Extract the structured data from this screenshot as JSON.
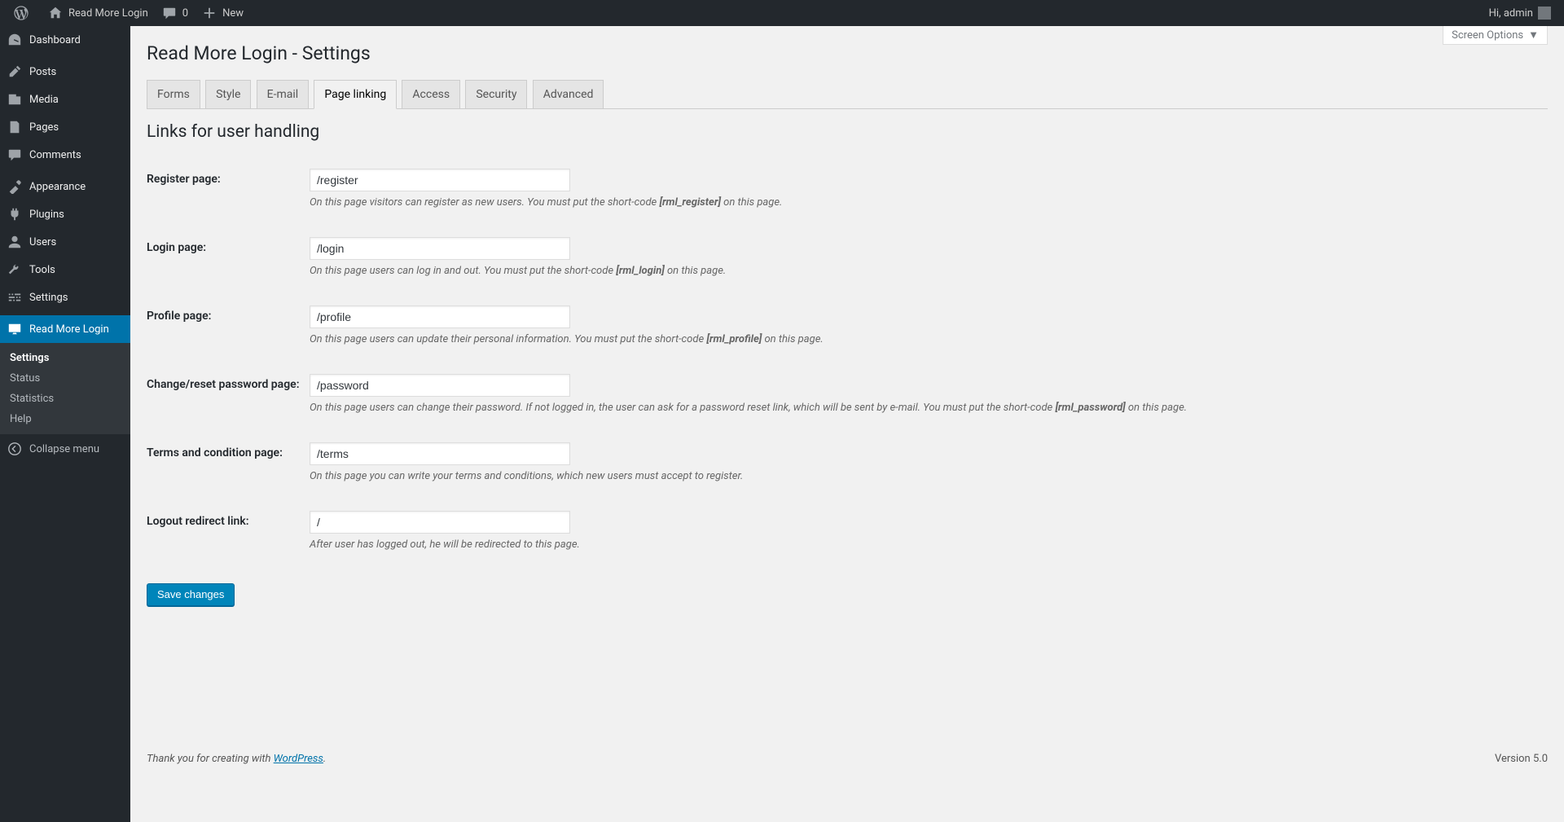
{
  "adminbar": {
    "site_name": "Read More Login",
    "comments_count": "0",
    "new_label": "New",
    "greeting": "Hi, admin"
  },
  "menu": {
    "items": [
      {
        "label": "Dashboard",
        "icon": "dashboard"
      },
      {
        "label": "Posts",
        "icon": "posts"
      },
      {
        "label": "Media",
        "icon": "media"
      },
      {
        "label": "Pages",
        "icon": "pages"
      },
      {
        "label": "Comments",
        "icon": "comments"
      },
      {
        "label": "Appearance",
        "icon": "appearance"
      },
      {
        "label": "Plugins",
        "icon": "plugins"
      },
      {
        "label": "Users",
        "icon": "users"
      },
      {
        "label": "Tools",
        "icon": "tools"
      },
      {
        "label": "Settings",
        "icon": "settings"
      },
      {
        "label": "Read More Login",
        "icon": "rml"
      }
    ],
    "submenu": [
      {
        "label": "Settings",
        "current": true
      },
      {
        "label": "Status"
      },
      {
        "label": "Statistics"
      },
      {
        "label": "Help"
      }
    ],
    "collapse": "Collapse menu"
  },
  "screen_options": "Screen Options",
  "page": {
    "title": "Read More Login - Settings",
    "section_title": "Links for user handling"
  },
  "tabs": [
    {
      "label": "Forms"
    },
    {
      "label": "Style"
    },
    {
      "label": "E-mail"
    },
    {
      "label": "Page linking",
      "active": true
    },
    {
      "label": "Access"
    },
    {
      "label": "Security"
    },
    {
      "label": "Advanced"
    }
  ],
  "fields": {
    "register": {
      "label": "Register page:",
      "value": "/register",
      "desc_a": "On this page visitors can register as new users. You must put the short-code ",
      "desc_code": "[rml_register]",
      "desc_b": " on this page."
    },
    "login": {
      "label": "Login page:",
      "value": "/login",
      "desc_a": "On this page users can log in and out. You must put the short-code ",
      "desc_code": "[rml_login]",
      "desc_b": " on this page."
    },
    "profile": {
      "label": "Profile page:",
      "value": "/profile",
      "desc_a": "On this page users can update their personal information. You must put the short-code ",
      "desc_code": "[rml_profile]",
      "desc_b": " on this page."
    },
    "password": {
      "label": "Change/reset password page:",
      "value": "/password",
      "desc_a": "On this page users can change their password. If not logged in, the user can ask for a password reset link, which will be sent by e-mail. You must put the short-code ",
      "desc_code": "[rml_password]",
      "desc_b": " on this page."
    },
    "terms": {
      "label": "Terms and condition page:",
      "value": "/terms",
      "desc_a": "On this page you can write your terms and conditions, which new users must accept to register.",
      "desc_code": "",
      "desc_b": ""
    },
    "logout": {
      "label": "Logout redirect link:",
      "value": "/",
      "desc_a": "After user has logged out, he will be redirected to this page.",
      "desc_code": "",
      "desc_b": ""
    }
  },
  "save_button": "Save changes",
  "footer": {
    "prefix": "Thank you for creating with ",
    "link": "WordPress",
    "suffix": ".",
    "version": "Version 5.0"
  }
}
